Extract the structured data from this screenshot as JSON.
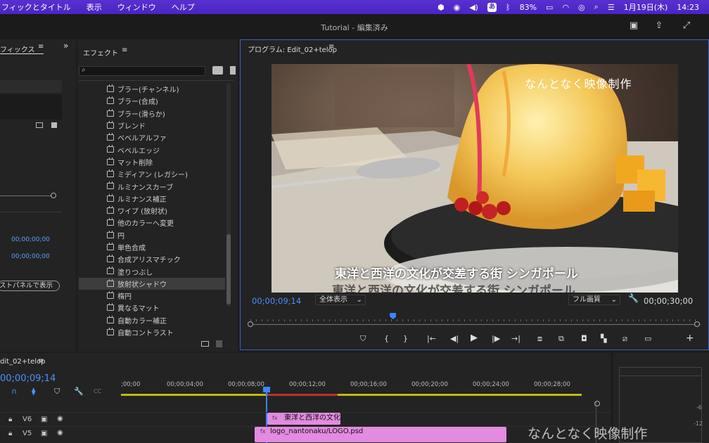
{
  "menubar": {
    "items": [
      "フィックとタイトル",
      "表示",
      "ウィンドウ",
      "ヘルプ"
    ],
    "battery": "83%",
    "input_mode": "あ",
    "date": "1月19日(木)",
    "time": "14:23"
  },
  "window": {
    "title": "Tutorial - 編集済み"
  },
  "left_panel": {
    "tab": "フィックス",
    "tc1": "00;00;00;00",
    "tc2": "00;00;00;00",
    "button": "ストパネルで表示"
  },
  "effects": {
    "tab": "エフェクト",
    "search_placeholder": "",
    "items": [
      "ブラー(チャンネル)",
      "ブラー(合成)",
      "ブラー(滑らか)",
      "ブレンド",
      "ベベルアルファ",
      "ベベルエッジ",
      "マット削除",
      "ミディアン (レガシー)",
      "ルミナンスカーブ",
      "ルミナンス補正",
      "ワイプ (放射状)",
      "他のカラーへ変更",
      "円",
      "単色合成",
      "合成アリスマチック",
      "塗りつぶし",
      "放射状シャドウ",
      "楕円",
      "異なるマット",
      "自動カラー補正",
      "自動コントラスト"
    ],
    "selected_index": 16
  },
  "program": {
    "tab": "プログラム: Edit_02+telop",
    "watermark": "なんとなく映像制作",
    "caption": "東洋と西洋の文化が交差する街 シンガポール",
    "current_tc": "00;00;09;14",
    "fit": "全体表示",
    "quality": "フル画質",
    "duration_tc": "00;00;30;00",
    "playhead_fraction": 0.316
  },
  "timeline": {
    "tab": "dit_02+telop",
    "current_tc": "00;00;09;14",
    "ruler": [
      ";00;00",
      "00;00;04;00",
      "00;00;08;00",
      "00;00;12;00",
      "00;00;16;00",
      "00;00;20;00",
      "00;00;24;00",
      "00;00;28;00"
    ],
    "tracks": [
      {
        "name": "V6",
        "clip": "東洋と西洋の文化"
      },
      {
        "name": "V5",
        "clip": "logo_nantonaku/LOGO.psd"
      }
    ]
  },
  "meter": {
    "labels": [
      "-6",
      "-12"
    ]
  },
  "overlay_watermark": "なんとなく映像制作"
}
